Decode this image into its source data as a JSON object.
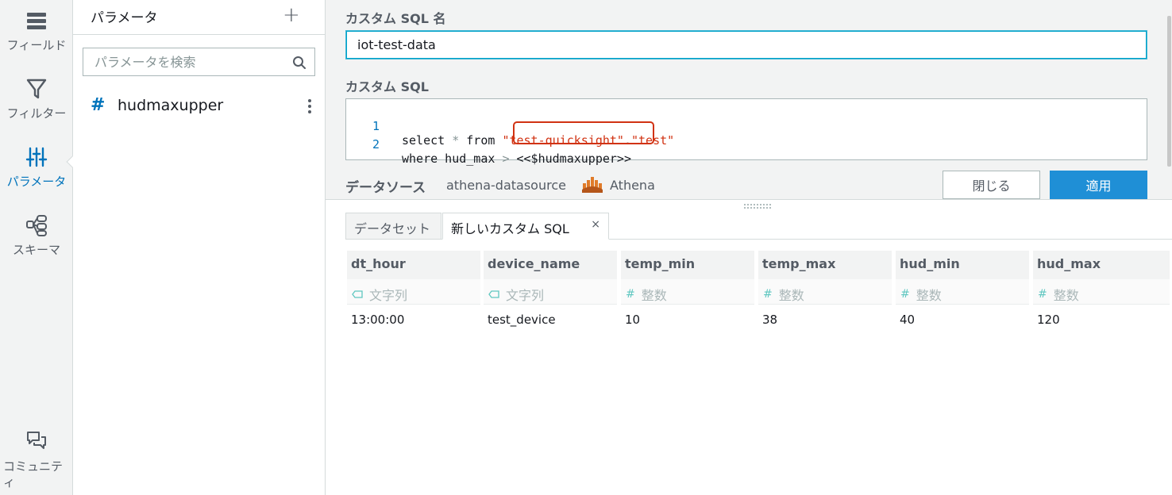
{
  "rail": {
    "fields_label": "フィールド",
    "filter_label": "フィルター",
    "param_label": "パラメータ",
    "schema_label": "スキーマ",
    "community_label": "コミュニティ"
  },
  "params": {
    "title": "パラメータ",
    "add_icon": "plus-icon",
    "search_placeholder": "パラメータを検索",
    "items": [
      {
        "name": "hudmaxupper",
        "type_icon": "hash-icon"
      }
    ]
  },
  "editor": {
    "name_label": "カスタム SQL 名",
    "name_value": "iot-test-data",
    "sql_label": "カスタム SQL",
    "lines": [
      {
        "num": "1",
        "a": "select ",
        "b": "* ",
        "c": "from ",
        "d": "\"test-quicksight\"",
        "e": ".",
        "f": "\"test\""
      },
      {
        "num": "2",
        "a": "where hud_max ",
        "b": "> ",
        "c": "<<$hudmaxupper>>"
      }
    ]
  },
  "datasource": {
    "label": "データソース",
    "name": "athena-datasource",
    "engine": "Athena"
  },
  "buttons": {
    "close": "閉じる",
    "apply": "適用"
  },
  "tabs": [
    {
      "label": "データセット"
    },
    {
      "label": "新しいカスタム SQL",
      "close": "×"
    }
  ],
  "table": {
    "columns": [
      {
        "name": "dt_hour",
        "type": "文字列",
        "kind": "string"
      },
      {
        "name": "device_name",
        "type": "文字列",
        "kind": "string"
      },
      {
        "name": "temp_min",
        "type": "整数",
        "kind": "int"
      },
      {
        "name": "temp_max",
        "type": "整数",
        "kind": "int"
      },
      {
        "name": "hud_min",
        "type": "整数",
        "kind": "int"
      },
      {
        "name": "hud_max",
        "type": "整数",
        "kind": "int"
      }
    ],
    "rows": [
      [
        "13:00:00",
        "test_device",
        "10",
        "38",
        "40",
        "120"
      ]
    ]
  },
  "colors": {
    "accent": "#0073bb",
    "apply_button": "#1f8fd6",
    "highlight": "#d13212"
  }
}
